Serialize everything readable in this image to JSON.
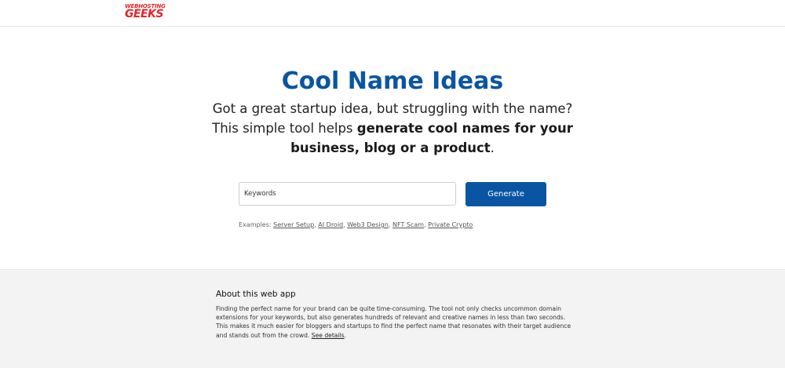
{
  "header": {
    "logo_top": "WEBHOSTING",
    "logo_bottom": "GEEKS",
    "logo_color": "#e8222a"
  },
  "hero": {
    "title": "Cool Name Ideas",
    "subtitle_line1": "Got a great startup idea, but struggling with the name?",
    "subtitle_prefix": "This simple tool helps ",
    "subtitle_bold": "generate cool names for your business, blog or a product",
    "subtitle_suffix": ".",
    "title_color": "#0a55a3"
  },
  "search": {
    "placeholder": "Keywords",
    "value": "",
    "button_label": "Generate",
    "button_color": "#0a55a3"
  },
  "examples": {
    "label": "Examples:",
    "items": [
      "Server Setup",
      "AI Droid",
      "Web3 Design",
      "NFT Scam",
      "Private Crypto"
    ]
  },
  "about": {
    "title": "About this web app",
    "text": "Finding the perfect name for your brand can be quite time-consuming. The tool not only checks uncommon domain extensions for your keywords, but also generates hundreds of relevant and creative names in less than two seconds. This makes it much easier for bloggers and startups to find the perfect name that resonates with their target audience and stands out from the crowd.",
    "link_label": "See details",
    "link_suffix": "."
  }
}
